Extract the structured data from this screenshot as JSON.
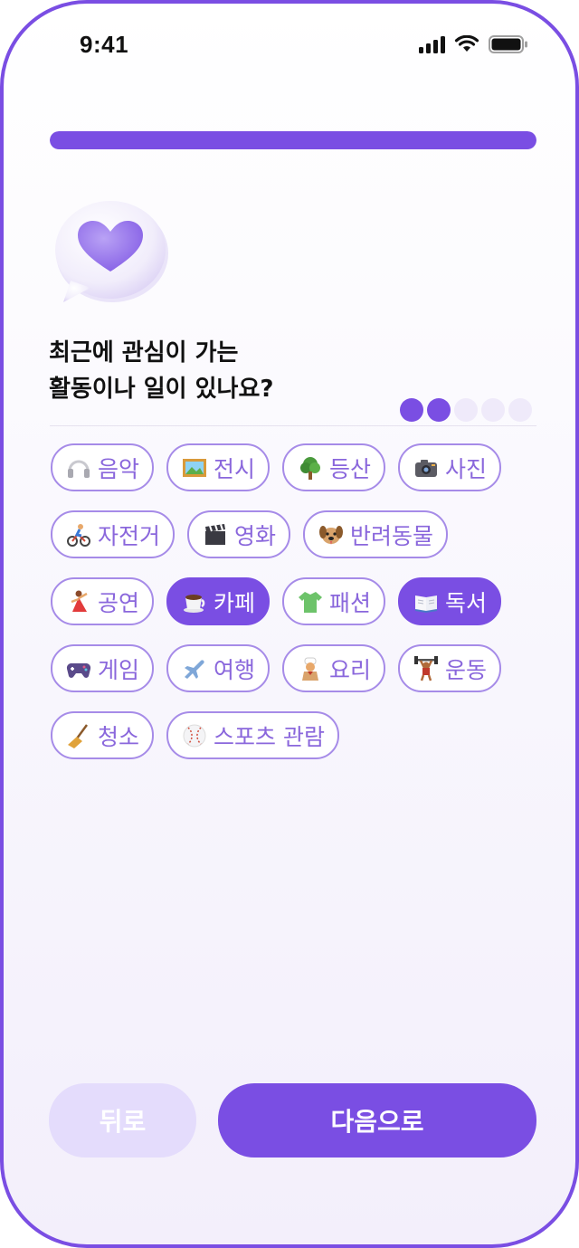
{
  "status_bar": {
    "time": "9:41"
  },
  "progress": {
    "value": 1.0
  },
  "question": {
    "line1": "최근에 관심이 가는",
    "line2": "활동이나 일이 있나요?"
  },
  "steps": {
    "total": 5,
    "completed": 2
  },
  "chips": [
    {
      "label": "음악",
      "icon": "headphones-icon",
      "selected": false
    },
    {
      "label": "전시",
      "icon": "framed-picture-icon",
      "selected": false
    },
    {
      "label": "등산",
      "icon": "tree-icon",
      "selected": false
    },
    {
      "label": "사진",
      "icon": "camera-icon",
      "selected": false
    },
    {
      "label": "자전거",
      "icon": "cyclist-icon",
      "selected": false
    },
    {
      "label": "영화",
      "icon": "clapperboard-icon",
      "selected": false
    },
    {
      "label": "반려동물",
      "icon": "dog-face-icon",
      "selected": false
    },
    {
      "label": "공연",
      "icon": "dancer-icon",
      "selected": false
    },
    {
      "label": "카페",
      "icon": "coffee-cup-icon",
      "selected": true
    },
    {
      "label": "패션",
      "icon": "t-shirt-icon",
      "selected": false
    },
    {
      "label": "독서",
      "icon": "open-book-icon",
      "selected": true
    },
    {
      "label": "게임",
      "icon": "game-controller-icon",
      "selected": false
    },
    {
      "label": "여행",
      "icon": "airplane-icon",
      "selected": false
    },
    {
      "label": "요리",
      "icon": "cook-icon",
      "selected": false
    },
    {
      "label": "운동",
      "icon": "weightlifter-icon",
      "selected": false
    },
    {
      "label": "청소",
      "icon": "broom-icon",
      "selected": false
    },
    {
      "label": "스포츠 관람",
      "icon": "baseball-icon",
      "selected": false
    }
  ],
  "buttons": {
    "back": "뒤로",
    "next": "다음으로"
  },
  "colors": {
    "accent": "#7a4ee3",
    "accent_light": "#e4dcfc",
    "chip_border": "#a68be8",
    "chip_text": "#8a67dc"
  }
}
